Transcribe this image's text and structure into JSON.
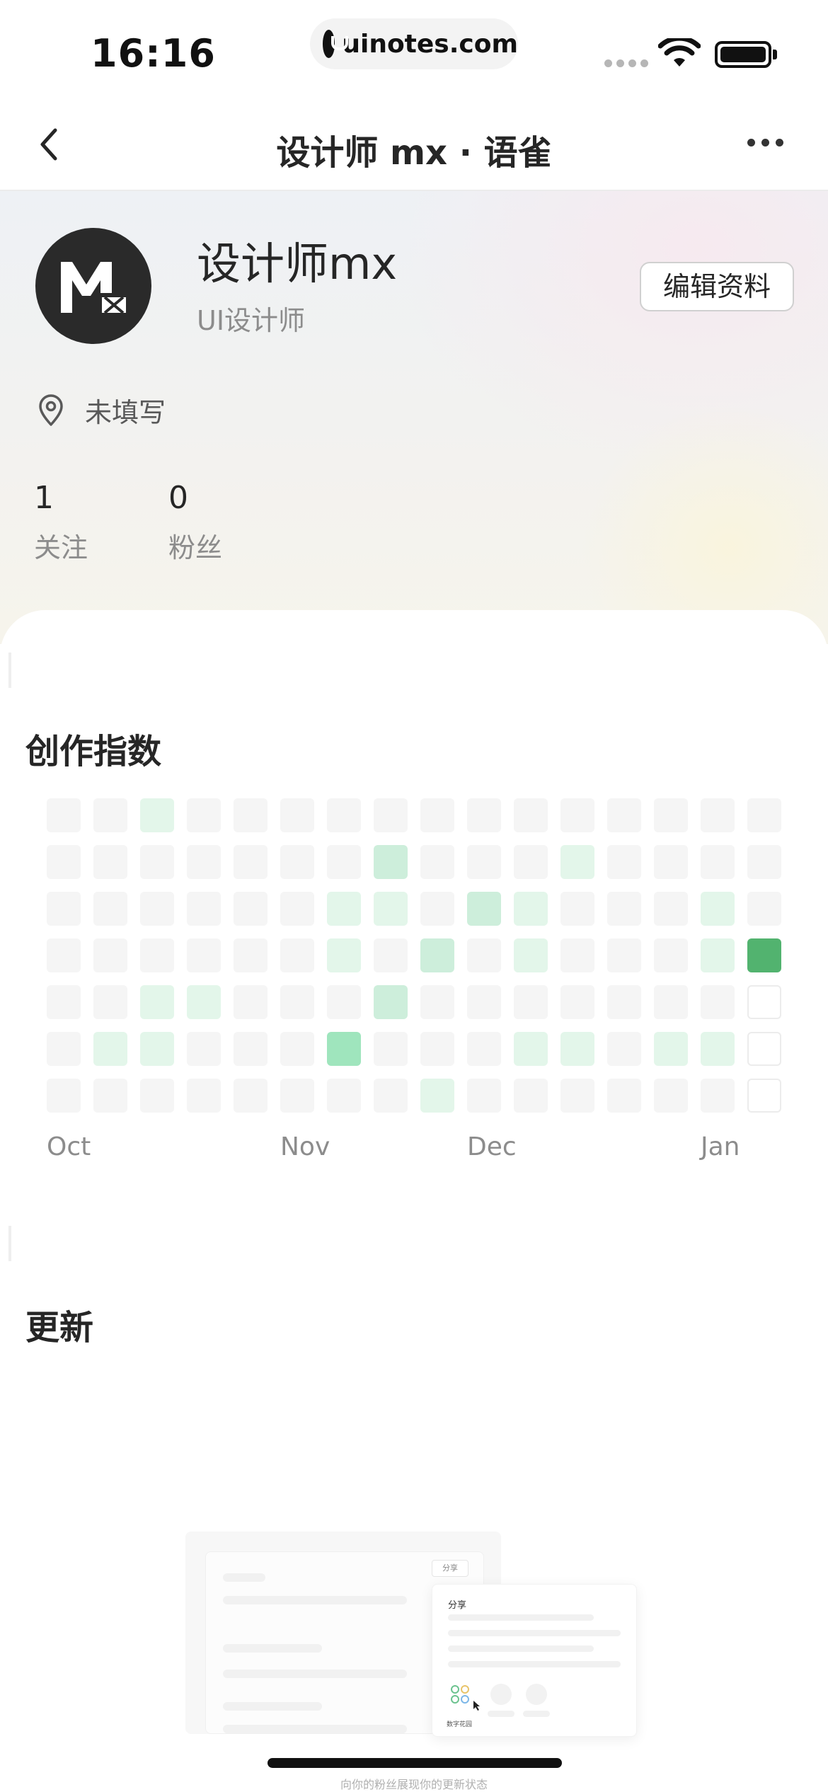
{
  "status_bar": {
    "time": "16:16",
    "url": "uinotes.com"
  },
  "nav": {
    "title": "设计师 mx · 语雀"
  },
  "profile": {
    "username": "设计师mx",
    "role": "UI设计师",
    "edit_label": "编辑资料",
    "location": "未填写",
    "following_count": "1",
    "following_label": "关注",
    "followers_count": "0",
    "followers_label": "粉丝"
  },
  "creation": {
    "title": "创作指数",
    "months": [
      "Oct",
      "Nov",
      "Dec",
      "Jan"
    ],
    "levels": [
      [
        0,
        0,
        1,
        0,
        0,
        0,
        0,
        0,
        0,
        0,
        0,
        0,
        0,
        0,
        0,
        0
      ],
      [
        0,
        0,
        0,
        0,
        0,
        0,
        0,
        2,
        0,
        0,
        0,
        1,
        0,
        0,
        0,
        0
      ],
      [
        0,
        0,
        0,
        0,
        0,
        0,
        1,
        1,
        0,
        2,
        1,
        0,
        0,
        0,
        1,
        0
      ],
      [
        0,
        0,
        0,
        0,
        0,
        0,
        1,
        0,
        2,
        0,
        1,
        0,
        0,
        0,
        1,
        4
      ],
      [
        0,
        0,
        1,
        1,
        0,
        0,
        0,
        2,
        0,
        0,
        0,
        0,
        0,
        0,
        0,
        -1
      ],
      [
        0,
        1,
        1,
        0,
        0,
        0,
        3,
        0,
        0,
        0,
        1,
        1,
        0,
        1,
        1,
        -1
      ],
      [
        0,
        0,
        0,
        0,
        0,
        0,
        0,
        0,
        1,
        0,
        0,
        0,
        0,
        0,
        0,
        -1
      ]
    ],
    "colors": {
      "empty": "#f5f5f5",
      "level1": "#e3f6ea",
      "level2": "#cdeedb",
      "level3": "#9fe5bd",
      "level4": "#52b36f",
      "future_border": "#ececec"
    }
  },
  "updates": {
    "title": "更新",
    "illustration": {
      "share_button": "分享",
      "share_title": "分享",
      "garden_label": "数字花园",
      "caption": "向你的粉丝展现你的更新状态"
    }
  }
}
